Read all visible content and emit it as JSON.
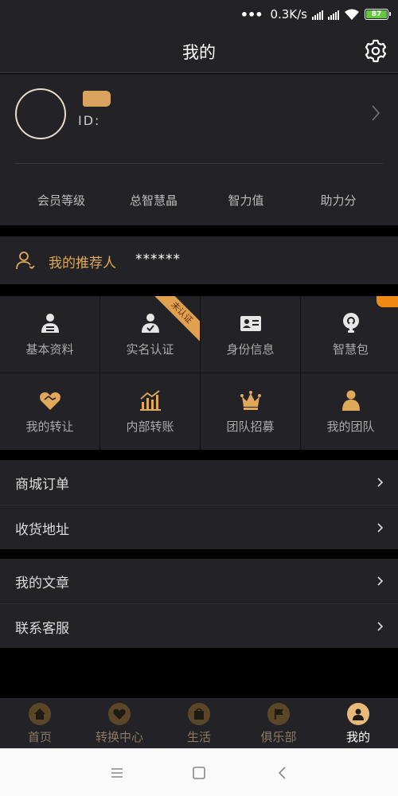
{
  "status_bar": {
    "speed": "0.3K/s",
    "battery": "87"
  },
  "header": {
    "title": "我的"
  },
  "profile": {
    "id_label": "ID:",
    "stats": [
      "会员等级",
      "总智慧晶",
      "智力值",
      "助力分"
    ]
  },
  "recommender": {
    "label": "我的推荐人",
    "value": "******"
  },
  "grid": {
    "items": [
      {
        "label": "基本资料",
        "icon": "id-card-person-icon"
      },
      {
        "label": "实名认证",
        "icon": "verified-user-icon",
        "ribbon": "未认证"
      },
      {
        "label": "身份信息",
        "icon": "id-card-icon"
      },
      {
        "label": "智慧包",
        "icon": "lightbulb-icon"
      },
      {
        "label": "我的转让",
        "icon": "handshake-icon"
      },
      {
        "label": "内部转账",
        "icon": "bar-chart-icon"
      },
      {
        "label": "团队招募",
        "icon": "crown-icon"
      },
      {
        "label": "我的团队",
        "icon": "team-icon"
      }
    ]
  },
  "menu_group_1": [
    {
      "label": "商城订单"
    },
    {
      "label": "收货地址"
    }
  ],
  "menu_group_2": [
    {
      "label": "我的文章"
    },
    {
      "label": "联系客服"
    }
  ],
  "tabbar": {
    "items": [
      {
        "label": "首页",
        "icon": "home-icon"
      },
      {
        "label": "转换中心",
        "icon": "handshake-icon"
      },
      {
        "label": "生活",
        "icon": "bag-icon"
      },
      {
        "label": "俱乐部",
        "icon": "flag-icon"
      },
      {
        "label": "我的",
        "icon": "user-icon",
        "active": true
      }
    ]
  },
  "colors": {
    "accent": "#e0a859",
    "panel": "#232327",
    "background": "#000000",
    "battery": "#62c93c",
    "badge": "#f08a14"
  }
}
